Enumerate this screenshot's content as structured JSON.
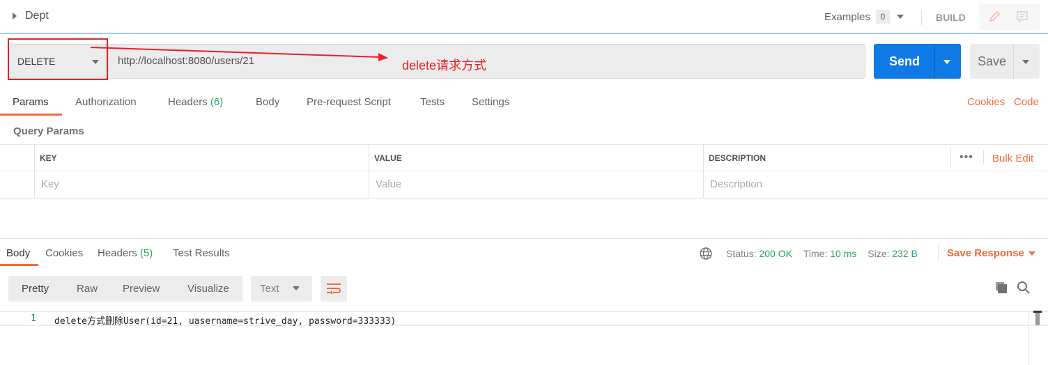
{
  "header": {
    "title": "Dept",
    "examples_label": "Examples",
    "examples_count": "0",
    "build_label": "BUILD"
  },
  "request": {
    "method": "DELETE",
    "url": "http://localhost:8080/users/21",
    "send_label": "Send",
    "save_label": "Save"
  },
  "annotation": {
    "text": "delete请求方式",
    "color": "#e8202a"
  },
  "request_tabs": [
    {
      "label": "Params"
    },
    {
      "label": "Authorization"
    },
    {
      "label": "Headers",
      "count": "(6)"
    },
    {
      "label": "Body"
    },
    {
      "label": "Pre-request Script"
    },
    {
      "label": "Tests"
    },
    {
      "label": "Settings"
    }
  ],
  "request_links": {
    "cookies": "Cookies",
    "code": "Code"
  },
  "query_params": {
    "title": "Query Params",
    "columns": [
      "KEY",
      "VALUE",
      "DESCRIPTION"
    ],
    "bulk_edit": "Bulk Edit",
    "placeholders": [
      "Key",
      "Value",
      "Description"
    ]
  },
  "response_tabs": [
    {
      "label": "Body"
    },
    {
      "label": "Cookies"
    },
    {
      "label": "Headers",
      "count": "(5)"
    },
    {
      "label": "Test Results"
    }
  ],
  "response_status": {
    "status_label": "Status:",
    "status": "200 OK",
    "time_label": "Time:",
    "time": "10 ms",
    "size_label": "Size:",
    "size": "232 B",
    "save_response": "Save Response"
  },
  "view_modes": [
    "Pretty",
    "Raw",
    "Preview",
    "Visualize"
  ],
  "format": "Text",
  "code_lines": [
    {
      "num": "1",
      "text": "delete方式删除User(id=21, uasername=strive_day, password=333333)"
    }
  ],
  "colors": {
    "accent": "#f26b3a",
    "send": "#0f7ae5",
    "success": "#26a55a"
  }
}
